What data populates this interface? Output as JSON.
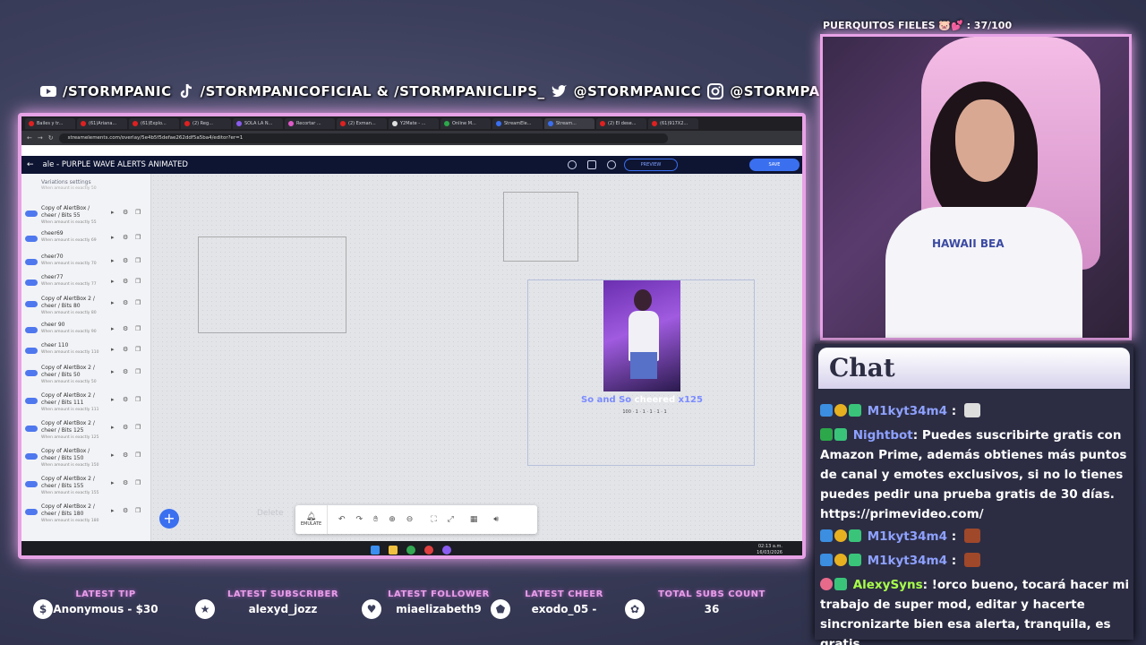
{
  "social": {
    "youtube": "/STORMPANIC",
    "tiktok": "/STORMPANICOFICIAL & /STORMPANICLIPS_",
    "twitter": "@STORMPANICC",
    "instagram": "@STORMPANIC"
  },
  "browser": {
    "tabs": [
      "Bailes y tr...",
      "(61)Ariana...",
      "(61)Explo...",
      "(2) Reg...",
      "SOLA LA N...",
      "Recortar ...",
      "(2) Exman...",
      "Y2Mate - ...",
      "Online M...",
      "StreamEle...",
      "Stream...",
      "(2) El dese...",
      "(61)917X2..."
    ],
    "url": "streamelements.com/overlay/5e4b5f5defae262ddf5a5ba4/editor?er=1",
    "page_title": "ale - PURPLE WAVE ALERTS ANIMATED",
    "preview_label": "PREVIEW",
    "save_label": "SAVE"
  },
  "sidebar": {
    "header": "Variations settings",
    "top_desc": "When amount is exactly 50",
    "items": [
      {
        "name": "Copy of AlertBox / cheer / Bits 55",
        "desc": "When amount is exactly 55"
      },
      {
        "name": "cheer69",
        "desc": "When amount is exactly 69"
      },
      {
        "name": "cheer70",
        "desc": "When amount is exactly 70"
      },
      {
        "name": "cheer77",
        "desc": "When amount is exactly 77"
      },
      {
        "name": "Copy of AlertBox 2 / cheer / Bits 80",
        "desc": "When amount is exactly 80"
      },
      {
        "name": "cheer 90",
        "desc": "When amount is exactly 90"
      },
      {
        "name": "cheer 110",
        "desc": "When amount is exactly 110"
      },
      {
        "name": "Copy of AlertBox 2 / cheer / Bits 50",
        "desc": "When amount is exactly 50"
      },
      {
        "name": "Copy of AlertBox 2 / cheer / Bits 111",
        "desc": "When amount is exactly 111"
      },
      {
        "name": "Copy of AlertBox 2 / cheer / Bits 125",
        "desc": "When amount is exactly 125"
      },
      {
        "name": "Copy of AlertBox / cheer / Bits 150",
        "desc": "When amount is exactly 150"
      },
      {
        "name": "Copy of AlertBox 2 / cheer / Bits 155",
        "desc": "When amount is exactly 155"
      },
      {
        "name": "Copy of AlertBox 2 / cheer / Bits 180",
        "desc": "When amount is exactly 180"
      }
    ]
  },
  "canvas": {
    "alert_name": "So and So",
    "alert_action": " cheered ",
    "alert_amount": "x125",
    "bits_row": "100 · 1 · 1 · 1 · 1 · 1",
    "delete_hint": "Delete",
    "emulate_label": "EMULATE",
    "add_button": "+"
  },
  "taskbar": {
    "time": "02:13 a.m.",
    "date": "16/03/2026"
  },
  "webcam": {
    "label": "PUERQUITOS FIELES 🐷💕 : 37/100",
    "shirt_text": "HAWAII BEA"
  },
  "chat": {
    "title": "Chat",
    "messages": [
      {
        "user": "M1kyt34m4",
        "text": ""
      },
      {
        "user": "Nightbot",
        "text": ": Puedes suscribirte gratis con Amazon Prime, además obtienes más puntos de canal y emotes exclusivos, si no lo tienes puedes pedir una prueba gratis de 30 días. https://primevideo.com/"
      },
      {
        "user": "M1kyt34m4",
        "text": ""
      },
      {
        "user": "M1kyt34m4",
        "text": ""
      },
      {
        "user": "AlexySyns",
        "text": ": !orco bueno, tocará hacer mi trabajo de super mod, editar y hacerte sincronizarte bien esa alerta, tranquila, es gratis"
      }
    ]
  },
  "stats": [
    {
      "label": "LATEST TIP",
      "value": "Anonymous - $30",
      "icon": "$"
    },
    {
      "label": "LATEST SUBSCRIBER",
      "value": "alexyd_jozz",
      "icon": "★"
    },
    {
      "label": "LATEST FOLLOWER",
      "value": "miaelizabeth9",
      "icon": "♥"
    },
    {
      "label": "LATEST CHEER",
      "value": "exodo_05 -",
      "icon": "⬟"
    },
    {
      "label": "TOTAL SUBS COUNT",
      "value": "36",
      "icon": "✿"
    }
  ],
  "colors": {
    "frame": "#e7a2e6",
    "accent_blue": "#3a6ff0",
    "chat_bg": "#2c2d43",
    "stat_label": "#e89ee7"
  }
}
